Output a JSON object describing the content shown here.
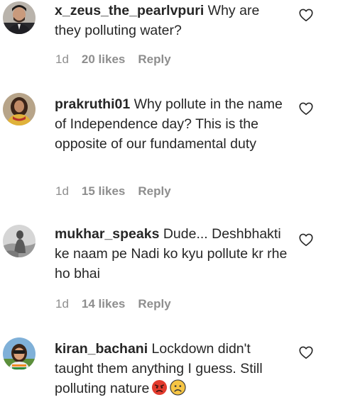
{
  "comments": [
    {
      "username": "x_zeus_the_pearlvpuri",
      "text": " Why are they polluting water?",
      "time": "1d",
      "likes": "20 likes",
      "reply": "Reply"
    },
    {
      "username": "prakruthi01",
      "text": " Why pollute in the name of Independence day? This is the opposite of our fundamental duty",
      "time": "1d",
      "likes": "15 likes",
      "reply": "Reply"
    },
    {
      "username": "mukhar_speaks",
      "text": " Dude... Deshbhakti ke naam pe Nadi ko kyu pollute kr rhe ho bhai",
      "time": "1d",
      "likes": "14 likes",
      "reply": "Reply"
    },
    {
      "username": "kiran_bachani",
      "text": " Lockdown didn't taught them anything I guess. Still polluting nature",
      "emojis": [
        "angry-face",
        "frowning-face"
      ]
    }
  ],
  "colors": {
    "text": "#262626",
    "meta": "#8e8e8e",
    "angry_emoji": "#e23b2e",
    "frown_emoji": "#f6c544"
  },
  "icons": [
    "heart-outline-icon",
    "angry-face-emoji",
    "frowning-face-emoji"
  ]
}
